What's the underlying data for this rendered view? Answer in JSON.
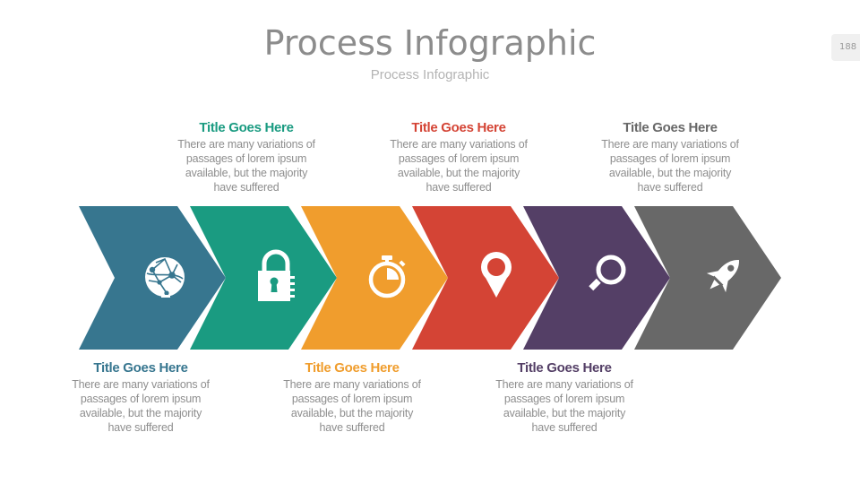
{
  "header": {
    "title": "Process Infographic",
    "subtitle": "Process Infographic",
    "page_number": "188"
  },
  "steps": [
    {
      "color": "#37768f",
      "icon": "globe-network-icon",
      "caption_position": "bottom",
      "title": "Title Goes Here",
      "body_lines": [
        "There are many variations of",
        "passages of lorem ipsum",
        "available, but the majority",
        "have suffered"
      ]
    },
    {
      "color": "#1a9b81",
      "icon": "padlock-icon",
      "caption_position": "top",
      "title": "Title Goes Here",
      "body_lines": [
        "There are many variations of",
        "passages of lorem ipsum",
        "available, but the majority",
        "have suffered"
      ]
    },
    {
      "color": "#f09d2d",
      "icon": "stopwatch-icon",
      "caption_position": "bottom",
      "title": "Title Goes Here",
      "body_lines": [
        "There are many variations of",
        "passages of lorem ipsum",
        "available, but the majority",
        "have suffered"
      ]
    },
    {
      "color": "#d44435",
      "icon": "map-pin-icon",
      "caption_position": "top",
      "title": "Title Goes Here",
      "body_lines": [
        "There are many variations of",
        "passages of lorem ipsum",
        "available, but the majority",
        "have suffered"
      ]
    },
    {
      "color": "#543f66",
      "icon": "magnifier-icon",
      "caption_position": "bottom",
      "title": "Title Goes Here",
      "body_lines": [
        "There are many variations of",
        "passages of lorem ipsum",
        "available, but the majority",
        "have suffered"
      ]
    },
    {
      "color": "#686868",
      "icon": "rocket-icon",
      "caption_position": "top",
      "title": "Title Goes Here",
      "body_lines": [
        "There are many variations of",
        "passages of lorem ipsum",
        "available, but the majority",
        "have suffered"
      ]
    }
  ]
}
